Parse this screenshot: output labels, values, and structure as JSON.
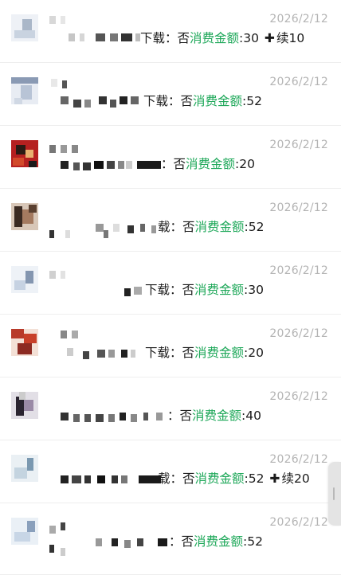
{
  "records": [
    {
      "date": "2026/2/12",
      "download_label": "下载：",
      "download_value": "否",
      "amount_label": "消费金额",
      "amount_value": ":30",
      "renew_label": "续",
      "renew_value": "10"
    },
    {
      "date": "2026/2/12",
      "download_label": "下载：",
      "download_value": "否",
      "amount_label": "消费金额",
      "amount_value": ":52"
    },
    {
      "date": "2026/2/12",
      "download_label": "：",
      "download_value": "否",
      "amount_label": "消费金额",
      "amount_value": ":20"
    },
    {
      "date": "2026/2/12",
      "download_label": "载：",
      "download_value": "否",
      "amount_label": "消费金额",
      "amount_value": ":52"
    },
    {
      "date": "2026/2/12",
      "download_label": "下载：",
      "download_value": "否",
      "amount_label": "消费金额",
      "amount_value": ":30"
    },
    {
      "date": "2026/2/12",
      "download_label": "下载：",
      "download_value": "否",
      "amount_label": "消费金额",
      "amount_value": ":20"
    },
    {
      "date": "2026/2/12",
      "download_label": "：",
      "download_value": "否",
      "amount_label": "消费金额",
      "amount_value": ":40"
    },
    {
      "date": "2026/2/12",
      "download_label": "载：",
      "download_value": "否",
      "amount_label": "消费金额",
      "amount_value": ":52",
      "renew_label": "续",
      "renew_value": "20"
    },
    {
      "date": "2026/2/12",
      "download_label": "：",
      "download_value": "否",
      "amount_label": "消费金额",
      "amount_value": ":52"
    }
  ],
  "colors": {
    "accent_green": "#1fa85a",
    "date_gray": "#b4b4b4",
    "text": "#1a1a1a",
    "divider": "#eeeeee"
  },
  "icons": {
    "plus": "plus-icon",
    "scroll": "scroll-handle-icon"
  }
}
